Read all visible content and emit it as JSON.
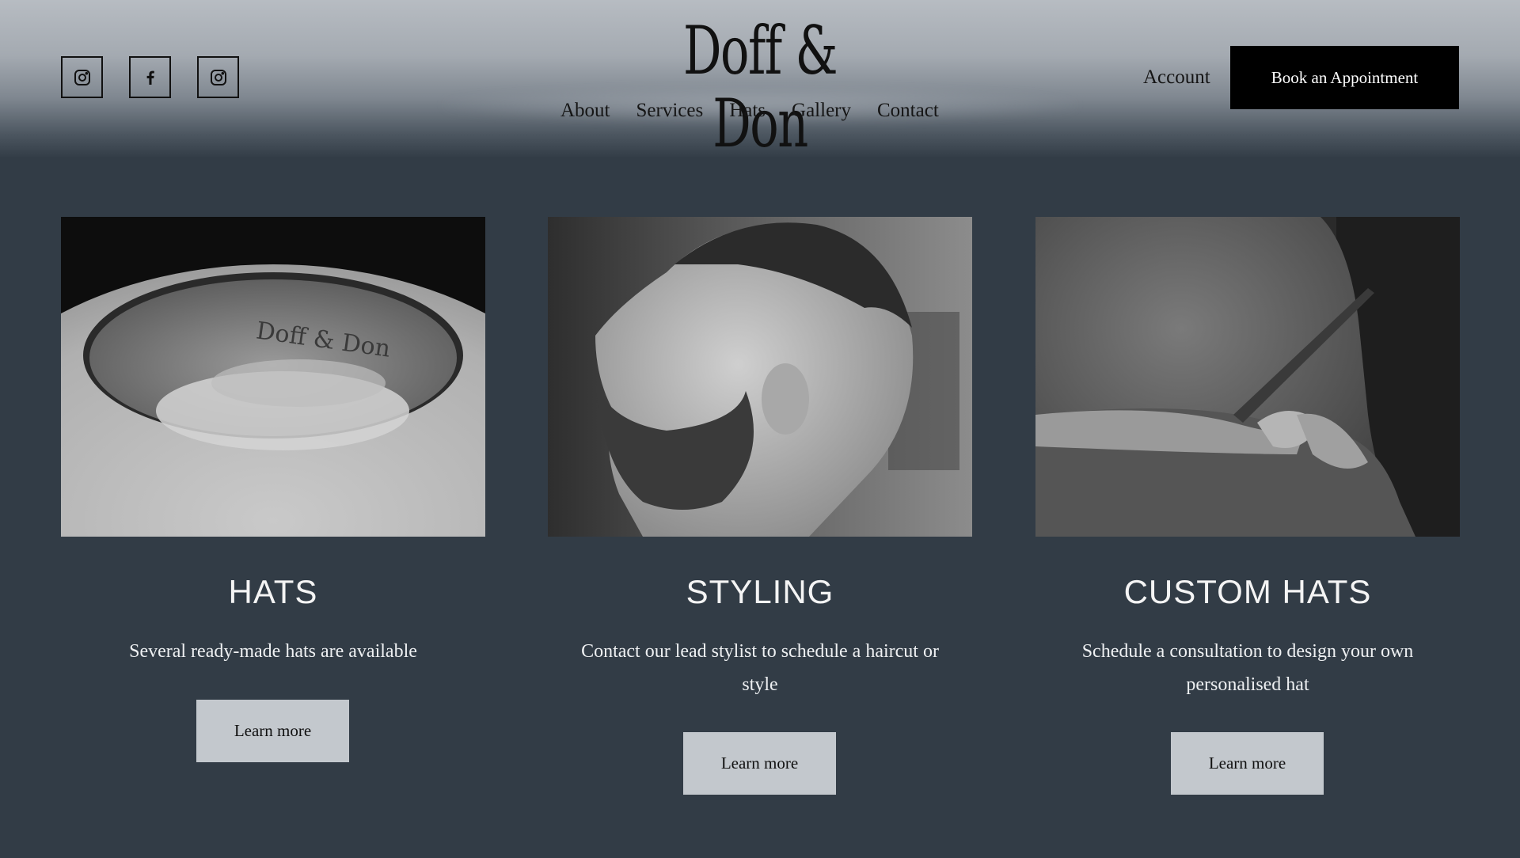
{
  "header": {
    "logo": "Doff & Don",
    "social": [
      {
        "icon": "instagram-icon"
      },
      {
        "icon": "facebook-icon"
      },
      {
        "icon": "instagram-icon"
      }
    ],
    "nav": [
      "About",
      "Services",
      "Hats",
      "Gallery",
      "Contact"
    ],
    "account_label": "Account",
    "book_label": "Book an Appointment"
  },
  "cards": [
    {
      "title": "HATS",
      "desc": "Several ready-made hats are available",
      "button": "Learn more",
      "image": "hat-interior-photo",
      "hat_stamp": "Doff & Don"
    },
    {
      "title": "STYLING",
      "desc": "Contact our lead stylist to schedule a haircut or style",
      "button": "Learn more",
      "image": "bearded-man-profile-photo"
    },
    {
      "title": "CUSTOM HATS",
      "desc": "Schedule a consultation to design your own personalised hat",
      "button": "Learn more",
      "image": "custom-hat-feather-photo"
    }
  ],
  "colors": {
    "background": "#323c46",
    "button_dark": "#000000",
    "button_light": "#c3c8cd"
  }
}
